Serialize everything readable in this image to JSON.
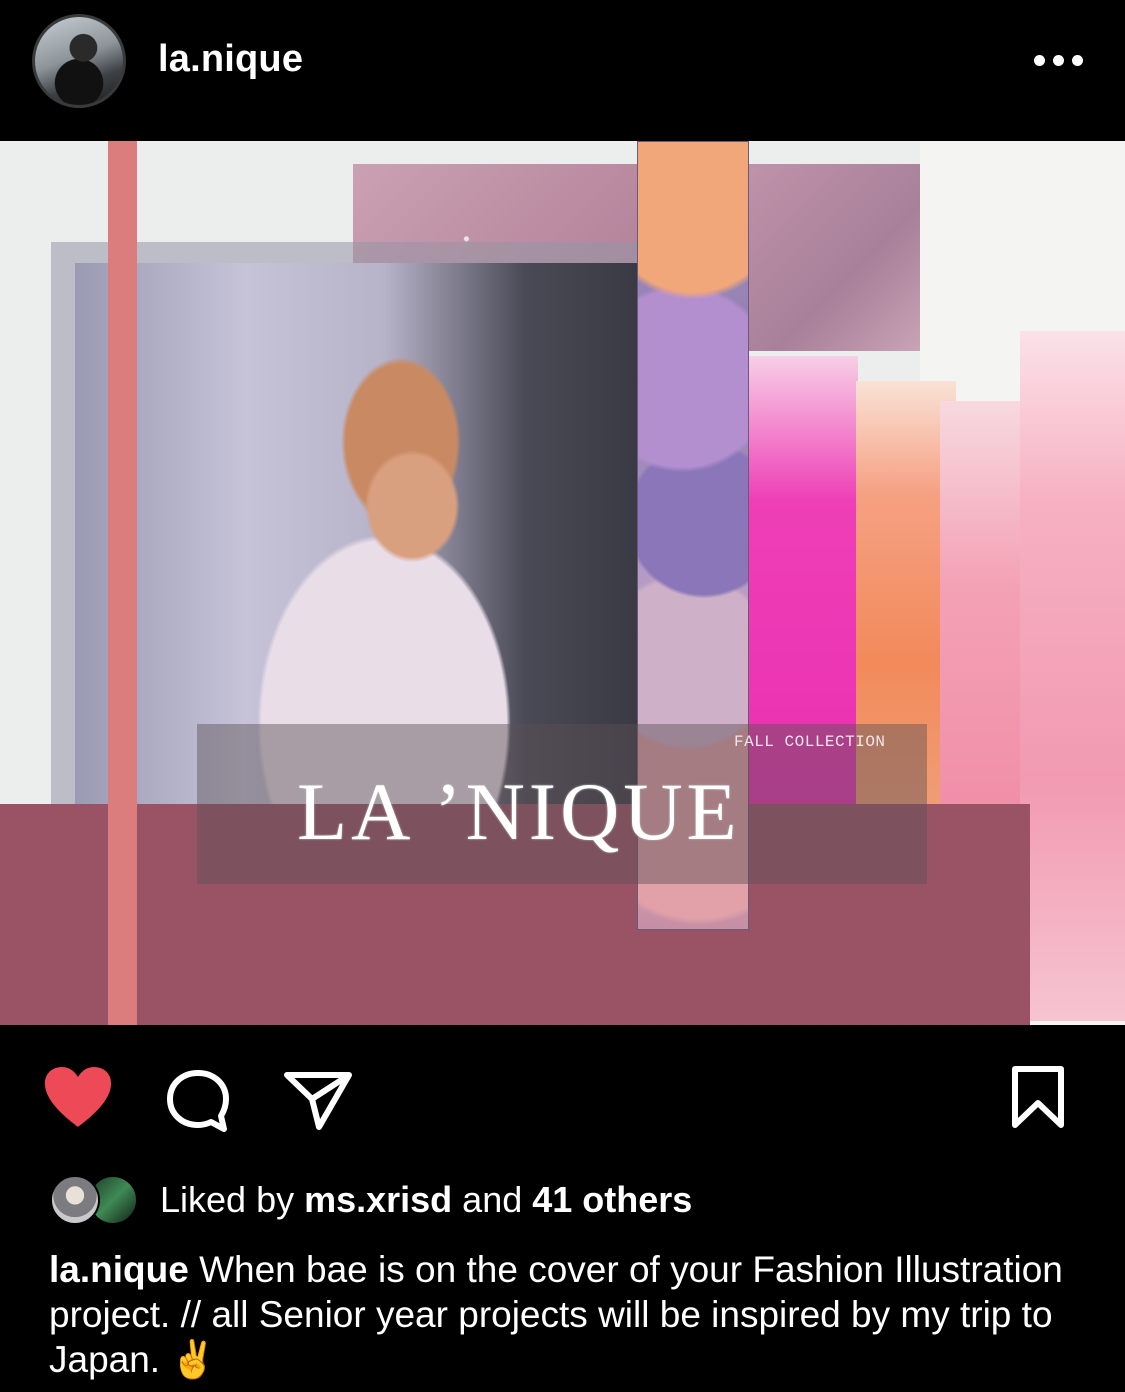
{
  "header": {
    "username": "la.nique",
    "more_icon": "more-horizontal-icon"
  },
  "post_image": {
    "fall_text": "FALL COLLECTION",
    "brand_text": "LA ’NIQUE",
    "colors": {
      "salmon": "#dc7d7d",
      "mauve": "#9a5364",
      "magenta": "#ea2fb1",
      "orange": "#f28a5a",
      "pink": "#f29ab1"
    }
  },
  "actions": {
    "like_icon": "heart-filled-icon",
    "like_color": "#ed4956",
    "comment_icon": "comment-icon",
    "share_icon": "share-icon",
    "save_icon": "bookmark-icon"
  },
  "likes": {
    "prefix": "Liked by ",
    "user": "ms.xrisd",
    "middle": " and ",
    "others": "41 others"
  },
  "caption": {
    "username": "la.nique",
    "text": "When bae is on the cover of your Fashion Illustration project. // all Senior year projects will be inspired by my trip to Japan.",
    "emoji": "✌️"
  }
}
